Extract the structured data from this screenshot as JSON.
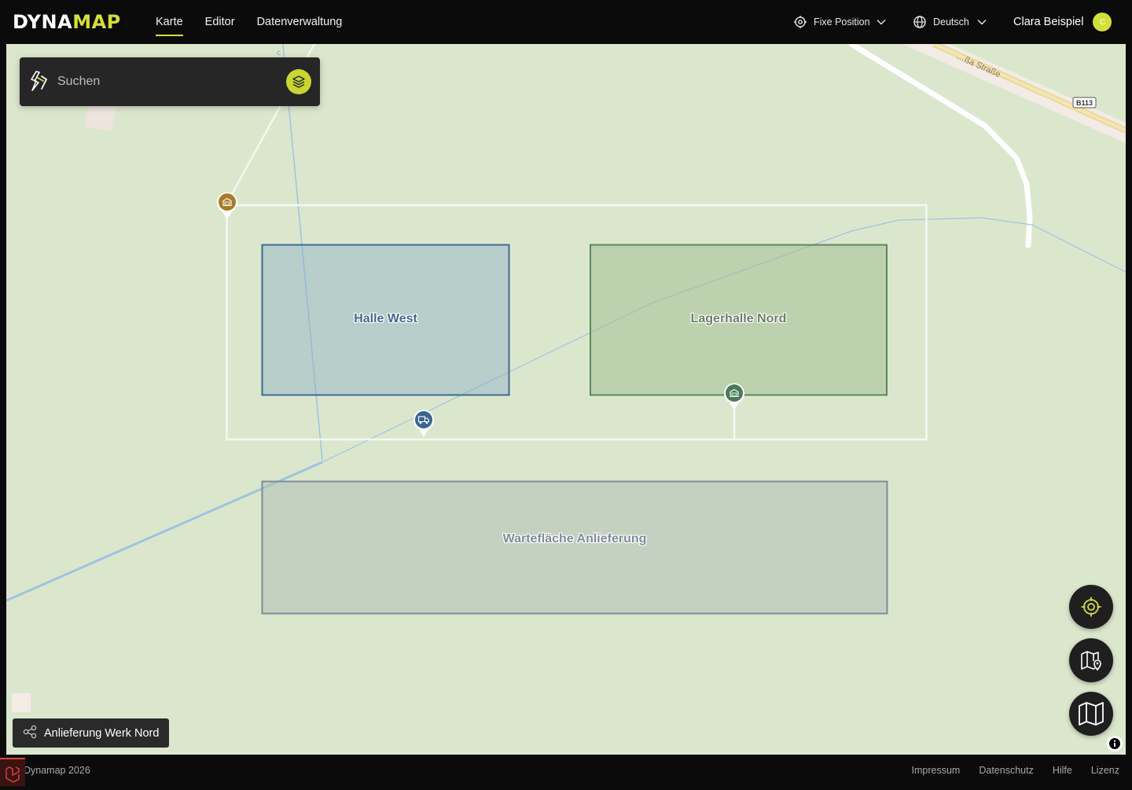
{
  "brand": {
    "part1": "DYNA",
    "part2": "MAP",
    "accent_color": "#d3df3a"
  },
  "nav": {
    "items": [
      {
        "label": "Karte",
        "active": true
      },
      {
        "label": "Editor",
        "active": false
      },
      {
        "label": "Datenverwaltung",
        "active": false
      }
    ]
  },
  "header": {
    "position_mode": {
      "label": "Fixe Position",
      "icon": "crosshair-icon"
    },
    "language": {
      "label": "Deutsch",
      "icon": "globe-icon"
    },
    "user": {
      "name": "Clara Beispiel",
      "initial": "C"
    }
  },
  "search": {
    "placeholder": "Suchen"
  },
  "map": {
    "street_label": "…ßa Straße",
    "road_shield": "B113",
    "zones": [
      {
        "label": "Halle West",
        "color": "#3d6990"
      },
      {
        "label": "Lagerhalle Nord",
        "color": "#6a7f6a"
      },
      {
        "label": "Wartefläche Anlieferung",
        "color": "#7f8b98"
      }
    ],
    "markers": [
      {
        "icon": "warehouse-icon",
        "color": "#a87b2a"
      },
      {
        "icon": "truck-icon",
        "color": "#3b6491"
      },
      {
        "icon": "warehouse-icon",
        "color": "#4a7a5a"
      }
    ]
  },
  "share": {
    "label": "Anlieferung Werk Nord",
    "icon": "share-icon"
  },
  "footer": {
    "copyright": "Dynamap 2026",
    "links": [
      "Impressum",
      "Datenschutz",
      "Hilfe",
      "Lizenz"
    ]
  }
}
